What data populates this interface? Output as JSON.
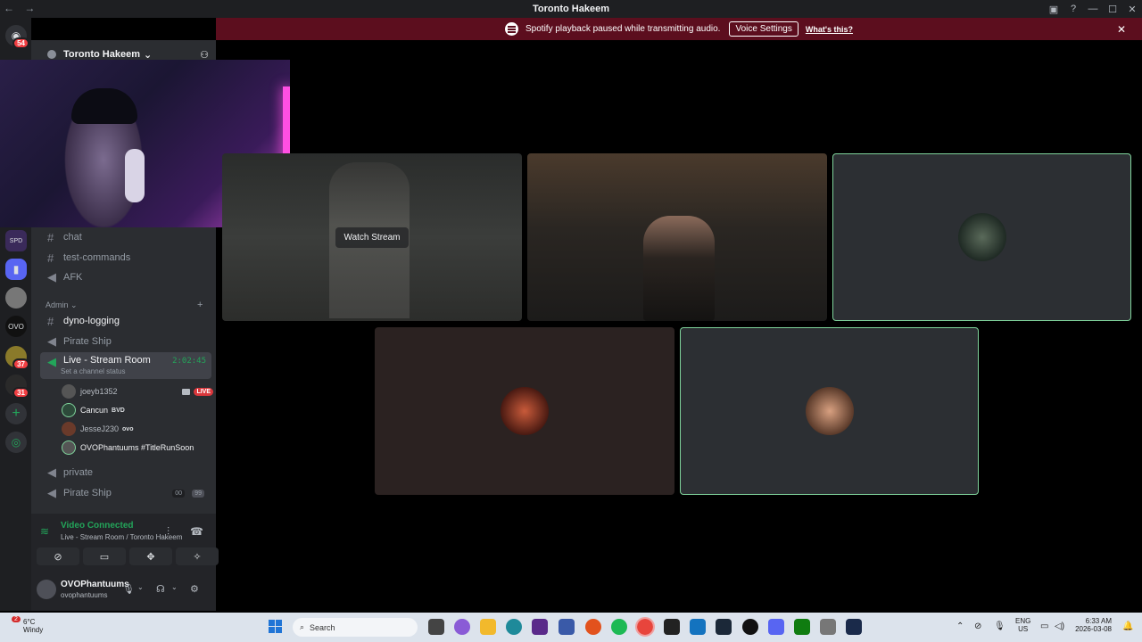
{
  "window": {
    "title": "Toronto Hakeem",
    "nav_back": "←",
    "nav_fwd": "→"
  },
  "banner": {
    "text": "Spotify playback paused while transmitting audio.",
    "button": "Voice Settings",
    "link": "What's this?",
    "close": "✕",
    "color": "#5c0e1e"
  },
  "guilds": {
    "dm_badge": "54",
    "badge_37": "37",
    "badge_31": "31"
  },
  "server": {
    "name": "Toronto Hakeem"
  },
  "channels": {
    "chat": "chat",
    "test_commands": "test-commands",
    "afk": "AFK",
    "admin_category": "Admin",
    "dyno_logging": "dyno-logging",
    "pirate_ship_1": "Pirate Ship",
    "live_room": "Live - Stream Room",
    "live_timer": "2:02:45",
    "live_status": "Set a channel status",
    "private": "private",
    "pirate_ship_2": "Pirate Ship",
    "pirate_counts": [
      "00",
      "99"
    ]
  },
  "voice_users": [
    {
      "name": "joeyb1352",
      "live": "LIVE"
    },
    {
      "name": "Cancun",
      "tag": "BVD"
    },
    {
      "name": "JesseJ230",
      "tag": "ovo"
    },
    {
      "name": "OVOPhantuums #TitleRunSoon"
    }
  ],
  "voice_panel": {
    "status": "Video Connected",
    "location": "Live - Stream Room / Toronto Hakeem"
  },
  "account": {
    "name": "OVOPhantuums",
    "handle": "ovophantuums"
  },
  "stage": {
    "watch_stream": "Watch Stream",
    "speaking_color": "#7fd39b"
  },
  "taskbar": {
    "temp": "6°C",
    "weather": "Windy",
    "search": "Search",
    "lang_1": "ENG",
    "lang_2": "US",
    "time": "6:33 AM",
    "date": "2026-03-08",
    "notif_badge": "2"
  }
}
